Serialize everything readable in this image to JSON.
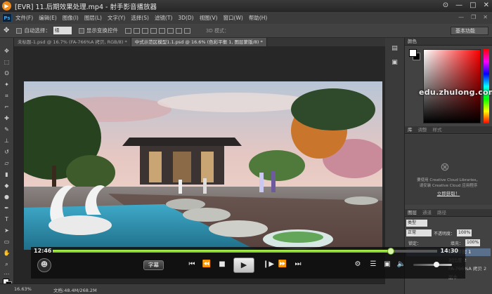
{
  "player": {
    "title": "[EVR] 11.后期效果处理.mp4 - 射手影音播放器",
    "time_current": "12:46",
    "time_total": "14:30",
    "progress": 0.88,
    "volume": 0.6,
    "subtitle_label": "字幕"
  },
  "menubar": {
    "logo": "Ps",
    "items": [
      "文件(F)",
      "编辑(E)",
      "图像(I)",
      "图层(L)",
      "文字(Y)",
      "选择(S)",
      "滤镜(T)",
      "3D(D)",
      "视图(V)",
      "窗口(W)",
      "帮助(H)"
    ]
  },
  "options": {
    "auto_select_label": "自动选择：",
    "auto_select_value": "组",
    "transform_label": "显示变换控件",
    "mode_3d": "3D 模式：",
    "workspace": "基本功能"
  },
  "tabs": [
    {
      "label": "未标题-1.psd @ 16.7% (FA-766%A 拷贝, RGB/8) *",
      "active": false
    },
    {
      "label": "中式示范区模型1.1.psd @ 16.6% (色彩平衡 1, 图层蒙版/8) *",
      "active": true
    }
  ],
  "panels": {
    "color_tab": "颜色",
    "library_tabs": [
      "库",
      "调整",
      "样式"
    ],
    "cc_text_1": "要使用 Creative Cloud Libraries，",
    "cc_text_2": "请安装 Creative Cloud 应用程序",
    "cc_link": "立即获取！",
    "layer_tabs": [
      "图层",
      "通道",
      "路径"
    ],
    "kind_label": "类型",
    "blend_mode": "正常",
    "opacity_label": "不透明度：",
    "opacity_value": "100%",
    "lock_label": "锁定：",
    "fill_label": "填充：",
    "fill_value": "100%",
    "layer_items": [
      "色彩平衡 1",
      "对比度 2",
      "FA-766%A 拷贝 2",
      "副本"
    ]
  },
  "status": {
    "zoom": "16.63%",
    "doc": "文档:48.4M/268.2M"
  },
  "watermark": "edu.zhulong.com",
  "colors": {
    "progress": "#7ed321",
    "accent_orange": "#f08a18"
  }
}
